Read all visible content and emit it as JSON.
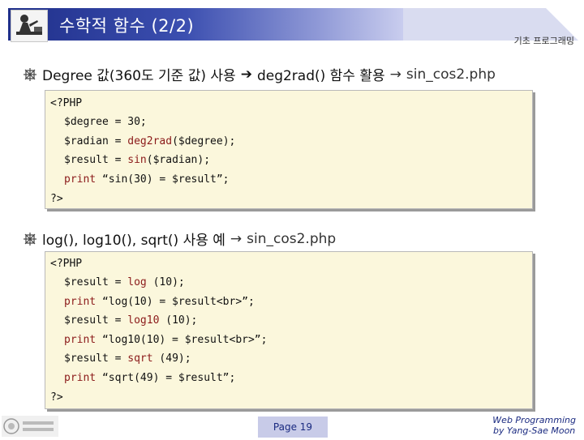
{
  "header": {
    "title": "수학적 함수 (2/2)",
    "course": "기초 프로그래밍"
  },
  "bullets": [
    {
      "text": "Degree 값(360도 기준 값) 사용",
      "arrow1": "➔",
      "middle": "deg2rad() 함수 활용",
      "arrow2": "→",
      "file": "sin_cos2.php"
    },
    {
      "text": "log(), log10(), sqrt() 사용 예",
      "arrow": "→",
      "file": "sin_cos2.php"
    }
  ],
  "code1": {
    "open": "<?PHP",
    "lines": [
      {
        "pre": "$degree = ",
        "fn": "",
        "post": "30;"
      },
      {
        "pre": "$radian = ",
        "fn": "deg2rad",
        "post": "($degree);"
      },
      {
        "pre": "$result = ",
        "fn": "sin",
        "post": "($radian);"
      },
      {
        "pre": "",
        "fn": "print",
        "post": " “sin(30) = $result”;"
      }
    ],
    "close": "?>"
  },
  "code2": {
    "open": "<?PHP",
    "lines": [
      {
        "pre": "$result = ",
        "fn": "log",
        "post": " (10);"
      },
      {
        "pre": "",
        "fn": "print",
        "post": " “log(10) = $result<br>”;"
      },
      {
        "pre": "$result = ",
        "fn": "log10",
        "post": " (10);"
      },
      {
        "pre": "",
        "fn": "print",
        "post": " “log10(10) = $result<br>”;"
      },
      {
        "pre": "$result = ",
        "fn": "sqrt",
        "post": " (49);"
      },
      {
        "pre": "",
        "fn": "print",
        "post": " “sqrt(49) = $result”;"
      }
    ],
    "close": "?>"
  },
  "footer": {
    "page": "Page 19",
    "credit_line1": "Web Programming",
    "credit_line2": "by Yang-Sae Moon"
  },
  "colors": {
    "title_bar": "#1f2f8a",
    "code_bg": "#fbf7dc",
    "function_text": "#8b1a1a"
  }
}
